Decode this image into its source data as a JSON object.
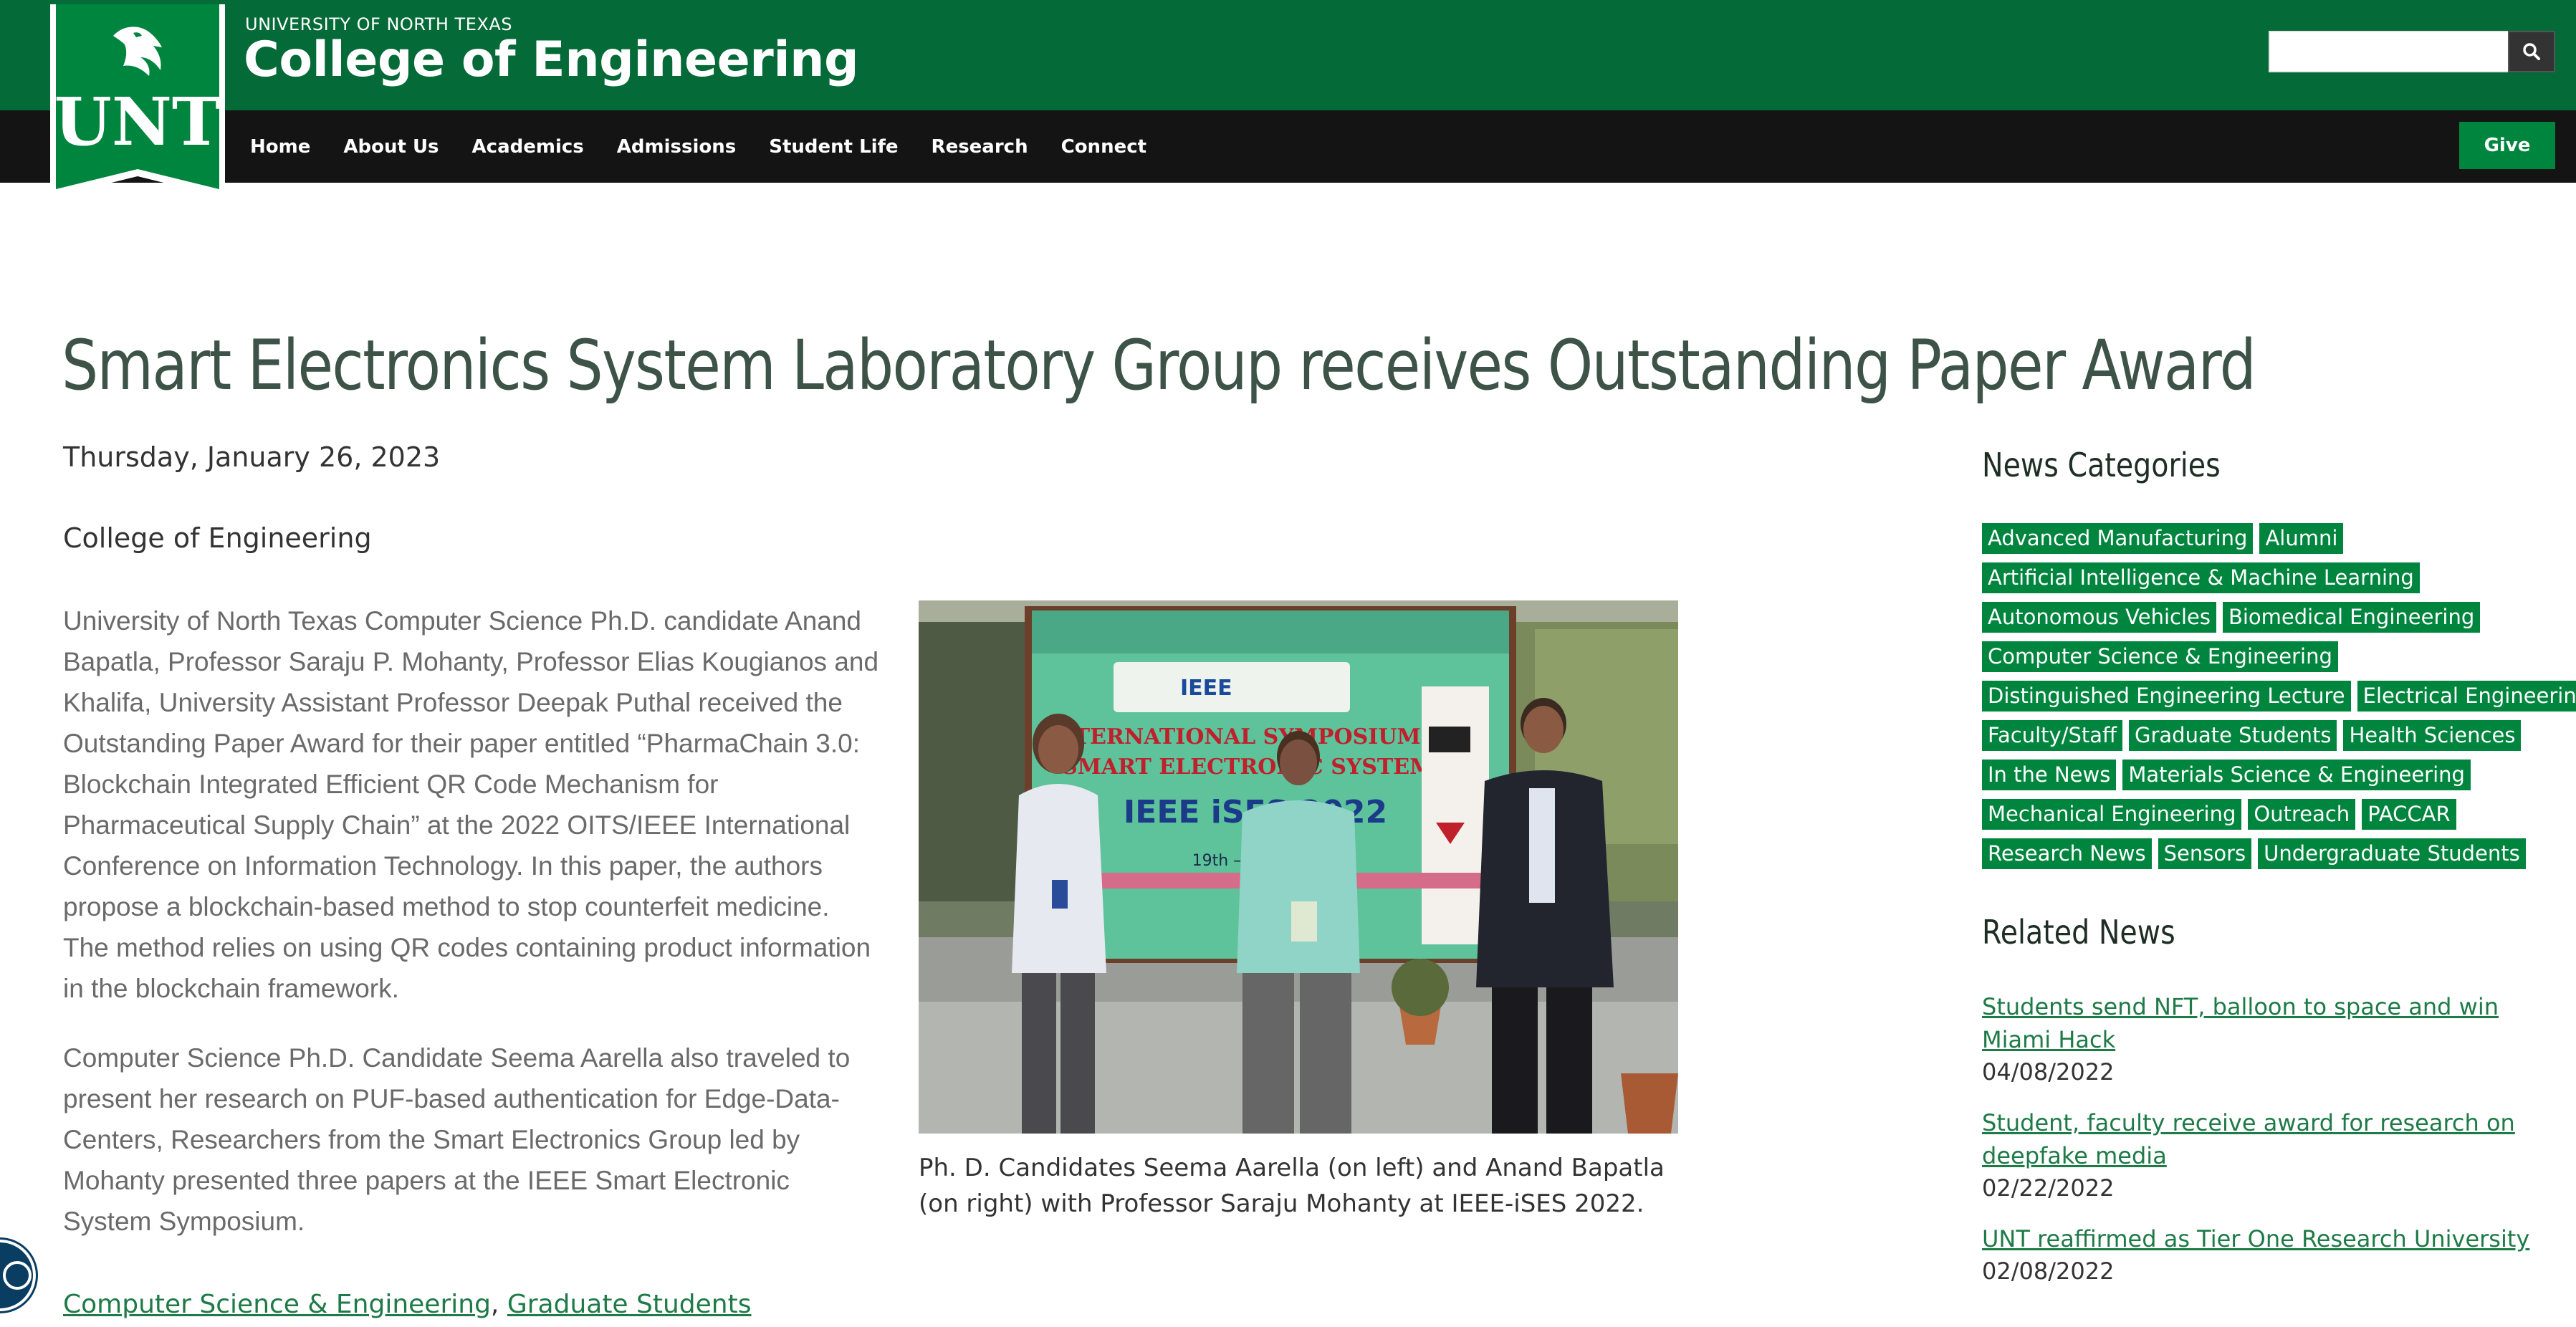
{
  "header": {
    "logo_text": "UNT",
    "university": "UNIVERSITY OF NORTH TEXAS",
    "college": "College of Engineering",
    "search_placeholder": "",
    "give_label": "Give"
  },
  "nav": {
    "items": [
      "Home",
      "About Us",
      "Academics",
      "Admissions",
      "Student Life",
      "Research",
      "Connect"
    ]
  },
  "article": {
    "title": "Smart Electronics System Laboratory Group receives Outstanding Paper Award",
    "date": "Thursday, January 26, 2023",
    "department": "College of Engineering",
    "paragraphs": [
      "University of North Texas Computer Science Ph.D. candidate Anand Bapatla, Professor Saraju P. Mohanty, Professor Elias Kougianos and Khalifa, University Assistant Professor Deepak Puthal received the Outstanding Paper Award for their paper entitled “PharmaChain 3.0: Blockchain Integrated Efficient QR Code Mechanism for Pharmaceutical Supply Chain” at the 2022 OITS/IEEE International Conference on Information Technology. In this paper, the authors propose a blockchain-based method to stop counterfeit medicine. The method relies on using QR codes containing product information in the blockchain framework.",
      "Computer Science Ph.D. Candidate Seema Aarella also traveled to present her research on PUF-based authentication for Edge-Data-Centers, Researchers from the Smart Electronics Group led by Mohanty presented three papers at the IEEE Smart Electronic System Symposium."
    ],
    "photo_caption": "Ph. D. Candidates Seema Aarella (on left) and Anand Bapatla (on right) with Professor Saraju Mohanty at IEEE-iSES 2022.",
    "banner_text": {
      "ieee": "IEEE",
      "line1": "INTERNATIONAL SYMPOSIUM ON",
      "line2": "SMART ELECTRONIC SYSTEMS",
      "line3": "IEEE iSES 2022",
      "dates": "19th – 21st DEC"
    },
    "tags": [
      "Computer Science & Engineering",
      "Graduate Students"
    ],
    "tag_separator": ","
  },
  "sidebar": {
    "categories_heading": "News Categories",
    "category_rows": [
      [
        "Advanced Manufacturing",
        "Alumni"
      ],
      [
        "Artificial Intelligence & Machine Learning"
      ],
      [
        "Autonomous Vehicles",
        "Biomedical Engineering"
      ],
      [
        "Computer Science & Engineering"
      ],
      [
        "Distinguished Engineering Lecture",
        "Electrical Engineering"
      ],
      [
        "Faculty/Staff",
        "Graduate Students",
        "Health Sciences"
      ],
      [
        "In the News",
        "Materials Science & Engineering"
      ],
      [
        "Mechanical Engineering",
        "Outreach",
        "PACCAR"
      ],
      [
        "Research News",
        "Sensors",
        "Undergraduate Students"
      ]
    ],
    "related_heading": "Related News",
    "related": [
      {
        "title": "Students send NFT, balloon to space and win Miami Hack",
        "date": "04/08/2022"
      },
      {
        "title": "Student, faculty receive award for research on deepfake media",
        "date": "02/22/2022"
      },
      {
        "title": "UNT reaffirmed as Tier One Research University",
        "date": "02/08/2022"
      }
    ]
  },
  "colors": {
    "brand_green": "#046a38",
    "accent_green": "#00853e",
    "nav_black": "#141414",
    "title_color": "#3d5348"
  },
  "icons": {
    "search": "search-icon",
    "logo": "eagle-logo-icon",
    "accessibility": "accessibility-icon"
  }
}
